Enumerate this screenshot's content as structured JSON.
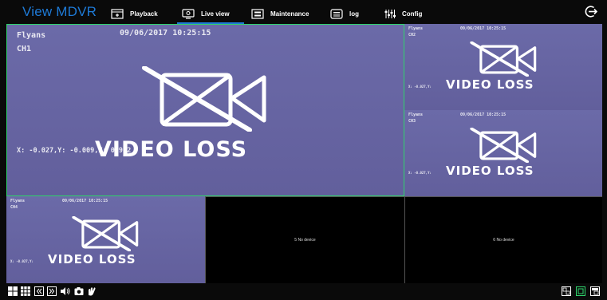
{
  "app": {
    "title": "View MDVR"
  },
  "nav": [
    {
      "label": "Playback",
      "icon": "calendar-icon"
    },
    {
      "label": "Live view",
      "icon": "monitor-icon",
      "active": true
    },
    {
      "label": "Maintenance",
      "icon": "maintenance-icon"
    },
    {
      "label": "log",
      "icon": "list-icon"
    },
    {
      "label": "Config",
      "icon": "config-icon"
    }
  ],
  "logout_icon": "logout-icon",
  "main_pane": {
    "name": "Flyans",
    "channel": "CH1",
    "datetime": "09/06/2017  10:25:15",
    "coords": "X: -0.027,Y: -0.009,Z: 0.962",
    "status": "VIDEO LOSS"
  },
  "side_panes": [
    {
      "name": "Flyans",
      "channel": "CH2",
      "datetime": "09/06/2017  10:25:15",
      "coords": "X: -0.027,Y:",
      "status": "VIDEO LOSS"
    },
    {
      "name": "Flyans",
      "channel": "CH3",
      "datetime": "09/06/2017  10:25:15",
      "coords": "X: -0.027,Y:",
      "status": "VIDEO LOSS"
    },
    {
      "name": "Flyans",
      "channel": "CH4",
      "datetime": "09/06/2017  10:25:15",
      "coords": "X: -0.027,Y:",
      "status": "VIDEO LOSS"
    }
  ],
  "no_device_panes": [
    {
      "label": "5 No device"
    },
    {
      "label": "6 No device"
    }
  ],
  "colors": {
    "accent": "#1e7ad6",
    "selected_border": "#2fd46c",
    "loss_bg": "#6b6aa8"
  },
  "bottom_left_icons": [
    "layout-4-icon",
    "layout-9-icon",
    "prev-page-icon",
    "next-page-icon",
    "volume-icon",
    "snapshot-icon",
    "ptz-icon"
  ],
  "bottom_right_icons": [
    "screen-split-icon",
    "fullscreen-icon",
    "window-icon"
  ]
}
